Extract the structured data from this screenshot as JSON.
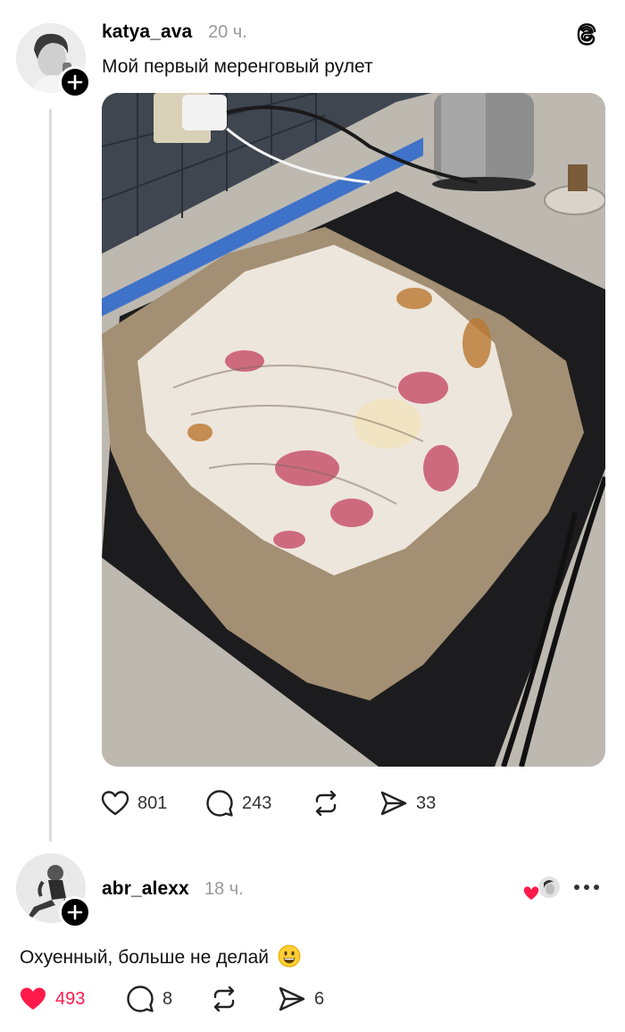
{
  "post": {
    "username": "katya_ava",
    "time": "20 ч.",
    "text": "Мой первый меренговый рулет",
    "likes": "801",
    "comments": "243",
    "shares": "33"
  },
  "reply": {
    "username": "abr_alexx",
    "time": "18 ч.",
    "text": "Охуенный, больше не делай",
    "likes": "493",
    "comments": "8",
    "shares": "6"
  },
  "colors": {
    "like_active": "#ff1a4a",
    "muted": "#9a9a9a"
  },
  "icons": [
    "threads-logo-icon",
    "heart-icon",
    "comment-icon",
    "repost-icon",
    "send-icon",
    "plus-icon",
    "more-icon",
    "grinning-face-emoji"
  ]
}
